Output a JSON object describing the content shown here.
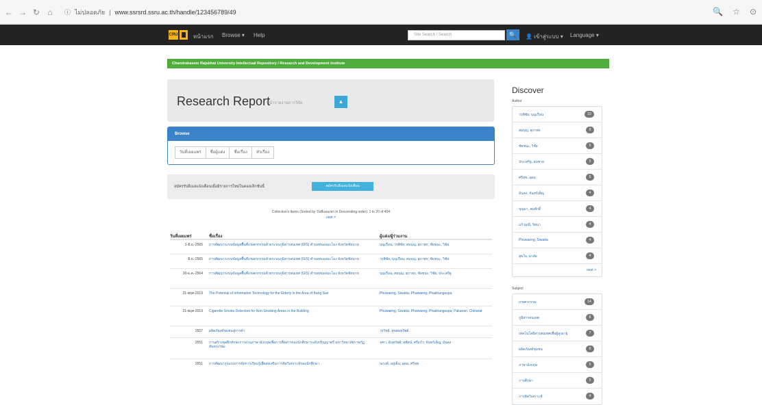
{
  "browser": {
    "nav_back": "←",
    "nav_forward": "→",
    "reload": "↻",
    "home": "⌂",
    "security": "ⓘ",
    "site_label": "ไม่ปลอดภัย",
    "url": "www.ssrsrd.ssru.ac.th/handle/123456789/49",
    "zoom": "🔍",
    "star": "☆",
    "account": "⊙"
  },
  "navbar": {
    "home": "หน้าแรก",
    "browse": "Browse ▾",
    "help": "Help",
    "search_placeholder": "Site Search / Search",
    "search_icon": "🔍",
    "user": "👤 เข้าสู่ระบบ ▾",
    "language": "Language ▾"
  },
  "breadcrumb": "Chandrakasem Rajabhat University Intellectual Repository / Research and Development Institute",
  "header": {
    "title": "Research Report",
    "subtitle": "หน้ารายงานการวิจัย",
    "rss_icon": "rss-icon"
  },
  "browse_panel": {
    "heading": "Browse",
    "buttons": [
      "วันที่เผยแพร่",
      "ชื่อผู้แต่ง",
      "ชื่อเรื่อง",
      "หัวเรื่อง"
    ]
  },
  "subscribe": {
    "text": "สมัครรับอีเมลแจ้งเตือนเมื่อมีรายการใหม่ในคอลเล็กชันนี้",
    "button": "สมัครรับอีเมลแจ้งเตือน"
  },
  "collection_info": {
    "line": "Collection's Items (Sorted by วันที่เผยแพร่ in Descending order): 1 to 20 of 404",
    "sort": "next >"
  },
  "table": {
    "headers": [
      "วันที่เผยแพร่",
      "ชื่อเรื่อง",
      "ผู้แต่ง/ผู้ร่วมงาน"
    ],
    "rows": [
      {
        "date": "1-มิ.ย.-2565",
        "title": "การพัฒนาระบบข้อมูลพื้นที่เกษตรกรรมด้วยระบบภูมิสารสนเทศ (GIS) ตำบลหนองมะโมง จังหวัดชัยนาท",
        "authors": "บุญเรือน, วรพิชัย; สมบุญ, สุภาพร; ชัยชนะ, วิชัย"
      },
      {
        "date": "มิ.ย.-2565",
        "title": "การพัฒนาระบบข้อมูลพื้นที่เกษตรกรรมด้วยระบบภูมิสารสนเทศ (GIS) ตำบลหนองมะโมง จังหวัดชัยนาท",
        "authors": "วรพิชัย, บุญเรือน; สมบุญ, สุภาพร; ชัยชนะ, วิชัย"
      },
      {
        "date": "30-ธ.ค.-2564",
        "title": "การพัฒนาระบบข้อมูลพื้นที่เกษตรกรรมด้วยระบบภูมิสารสนเทศ (GIS) ตำบลหนองมะโมง จังหวัดชัยนาท",
        "authors": "บุญเรือน, สมบุญ; สุภาพร, ชัยชนะ; วิชัย, ประเสริฐ"
      },
      {
        "date": "21-พฤศ-2019",
        "title": "The Potential of Information Technology for the Elderly in the Area of Bang Sue",
        "authors": "Phuwaeng, Siwatta; Phuwaeng, Phakhangsupa"
      },
      {
        "date": "21-พฤศ-2019",
        "title": "Cigarette Smoke Detectors for Non Smoking Areas in the Building",
        "authors": "Phuwaeng, Siwatta; Phuwaeng, Phakhangsupa; Pakanan, Chinarat"
      },
      {
        "date": "2557",
        "title": "ผลิตภัณฑ์ชุมชนสู่การค้า",
        "authors": "วรวิทย์, สุขสมทรัพย์"
      },
      {
        "date": "2551",
        "title": "การสร้างชุดฝึกทักษะการอ่านภาษาอังกฤษเพื่อการสื่อสารของนักศึกษาระดับปริญญาตรี มหาวิทยาลัยราชภัฏจันทรเกษม",
        "authors": "จุฑา, อ้นทรัพย์; สุทัศน์, ศรีแก้ว; จันทร์เพ็ญ, มั่นคง"
      },
      {
        "date": "2551",
        "title": "การพัฒนารูปแบบการจัดการเรียนรู้เพื่อส่งเสริมการคิดวิเคราะห์ของนักศึกษา",
        "authors": "ณรงค์, อยู่เย็น; อุดม, ศรีสุข"
      }
    ]
  },
  "sidebar": {
    "discover": "Discover",
    "author_label": "Author",
    "authors": [
      {
        "name": "วรพิชัย, บุญเรือน",
        "count": "10"
      },
      {
        "name": "สมบุญ, สุภาพร",
        "count": "9"
      },
      {
        "name": "ชัยชนะ, วิชัย",
        "count": "6"
      },
      {
        "name": "ประเสริฐ, สมชาย",
        "count": "5"
      },
      {
        "name": "ศรีสุข, อุดม",
        "count": "5"
      },
      {
        "name": "มั่นคง, จันทร์เพ็ญ",
        "count": "4"
      },
      {
        "name": "บุญมา, สมศักดิ์",
        "count": "4"
      },
      {
        "name": "แก้วมณี, รัตนา",
        "count": "4"
      },
      {
        "name": "Phuwaeng, Siwatta",
        "count": "4"
      },
      {
        "name": "สุขใจ, มาลัย",
        "count": "4"
      }
    ],
    "more": "next >",
    "subject_label": "Subject",
    "subjects": [
      {
        "name": "เกษตรกรรม",
        "count": "14"
      },
      {
        "name": "ภูมิสารสนเทศ",
        "count": "8"
      },
      {
        "name": "เทคโนโลยีสารสนเทศเพื่อผู้สูงอายุ",
        "count": "7"
      },
      {
        "name": "ผลิตภัณฑ์ชุมชน",
        "count": "6"
      },
      {
        "name": "ภาษาอังกฤษ",
        "count": "5"
      },
      {
        "name": "การศึกษา",
        "count": "5"
      },
      {
        "name": "การคิดวิเคราะห์",
        "count": "4"
      }
    ]
  }
}
